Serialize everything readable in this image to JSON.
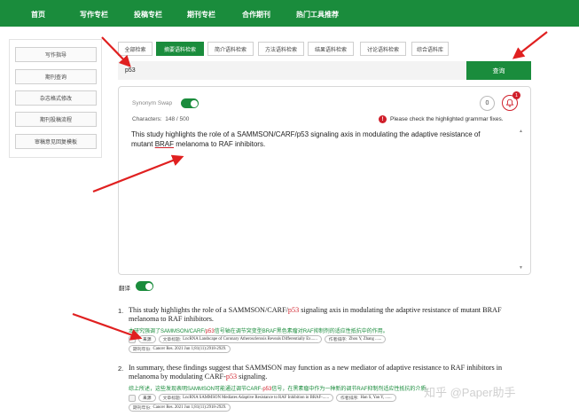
{
  "nav": {
    "items": [
      "首页",
      "写作专栏",
      "投稿专栏",
      "期刊专栏",
      "合作期刊",
      "热门工具推荐"
    ]
  },
  "sidebar": {
    "items": [
      "写作指导",
      "期刊查询",
      "杂志格式修改",
      "期刊投稿流程",
      "审稿意见回复模板"
    ]
  },
  "tabs": {
    "items": [
      "全部检索",
      "摘要语料检索",
      "简介语料检索",
      "方法语料检索",
      "结果语料检索",
      "讨论语料检索",
      "综合语料库"
    ],
    "active_index": 1
  },
  "search": {
    "value": "p53",
    "button_label": "查询"
  },
  "editor": {
    "synonym_label": "Synonym Swap",
    "synonym_on": true,
    "characters_label": "Characters:",
    "characters_value": "148 / 500",
    "counter_value": "0",
    "bell_badge": "1",
    "warning_icon": "!",
    "warning_text": "Please check the highlighted grammar fixes.",
    "text_before": "This study highlights the role of a SAMMSON/CARF/p53 signaling axis in modulating the adaptive resistance of mutant ",
    "text_highlight": "BRAF",
    "text_after": " melanoma to RAF inhibitors."
  },
  "translate": {
    "label": "翻译",
    "on": true
  },
  "results": [
    {
      "num": "1.",
      "en_before": "This study highlights the role of a SAMMSON/CARF/",
      "en_red": "p53",
      "en_after": " signaling axis in modulating the adaptive resistance of mutant BRAF melanoma to RAF inhibitors.",
      "zh_before": "本研究强调了SAMMSON/CARF/",
      "zh_red": "p53",
      "zh_after": "信号轴在调节突变型BRAF黑色素瘤对RAF抑制剂的适应性抵抗中的作用。",
      "source_label": "来源",
      "title_label": "文章标题:",
      "title_value": "LncRNA Landscape of Coronary Atherosclerosis Reveals Differentially Ex......",
      "author_label": "作者排序:",
      "author_value": "Zhou Y, Zhang ......",
      "journal_label": "期刊年份:",
      "journal_value": "Cancer Res. 2021 Jun 1;81(11):2918-2929."
    },
    {
      "num": "2.",
      "en_before": "In summary, these findings suggest that SAMMSON may function as a new mediator of adaptive resistance to RAF inhibitors in melanoma by modulating CARF-",
      "en_red": "p53",
      "en_after": " signaling.",
      "zh_before": "综上所述，这些发现表明SAMMSON可能通过调节CARF-",
      "zh_red": "p53",
      "zh_after": "信号，在黑素瘤中作为一种新的调节RAF抑制剂适应性抵抗的介质。",
      "source_label": "来源",
      "title_label": "文章标题:",
      "title_value": "LncRNA SAMMSON Mediates Adaptive Resistance to RAF Inhibition in BRAF-......",
      "author_label": "作者排序:",
      "author_value": "Han S, Yan Y, ......",
      "journal_label": "期刊年份:",
      "journal_value": "Cancer Res. 2021 Jun 1;81(11):2918-2929."
    }
  ],
  "watermark": "知乎 @Paper助手",
  "colors": {
    "brand": "#1a8c3c",
    "alert": "#d01f2a",
    "arrow": "#e02020"
  }
}
